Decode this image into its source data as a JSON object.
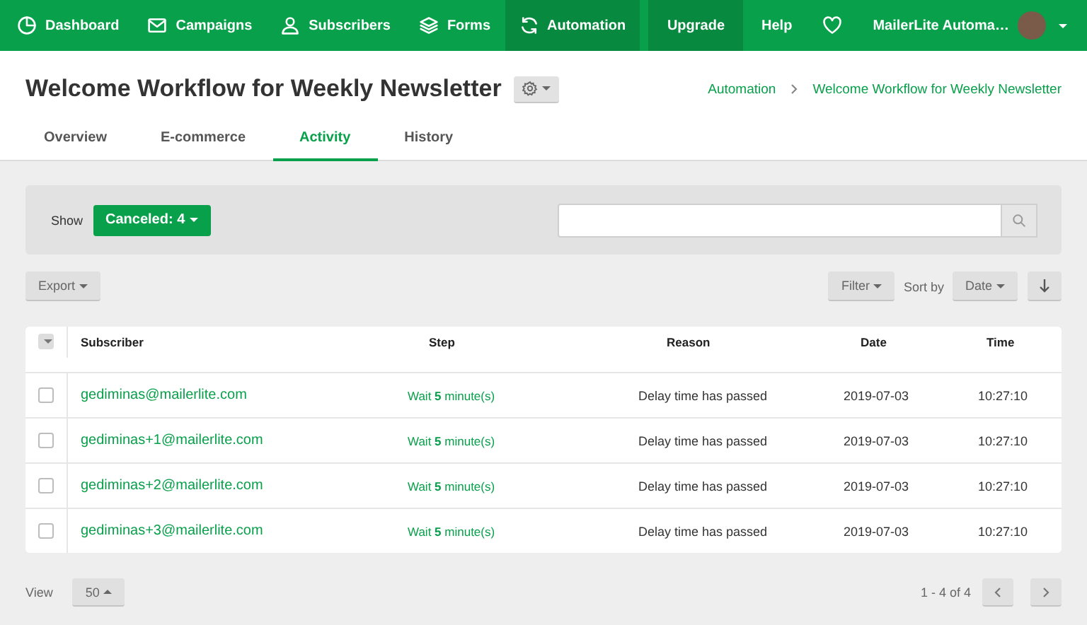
{
  "nav": {
    "items": [
      {
        "label": "Dashboard",
        "selected": false
      },
      {
        "label": "Campaigns",
        "selected": false
      },
      {
        "label": "Subscribers",
        "selected": false
      },
      {
        "label": "Forms",
        "selected": false
      },
      {
        "label": "Automation",
        "selected": true
      }
    ],
    "upgrade": "Upgrade",
    "help": "Help",
    "user": "MailerLite Automa…"
  },
  "header": {
    "title": "Welcome Workflow for Weekly Newsletter",
    "breadcrumb": [
      "Automation",
      "Welcome Workflow for Weekly Newsletter"
    ],
    "tabs": [
      {
        "label": "Overview",
        "selected": false
      },
      {
        "label": "E-commerce",
        "selected": false
      },
      {
        "label": "Activity",
        "selected": true
      },
      {
        "label": "History",
        "selected": false
      }
    ]
  },
  "filter": {
    "show_label": "Show",
    "status_button": "Canceled: 4"
  },
  "toolbar": {
    "export": "Export",
    "filter": "Filter",
    "sort_label": "Sort by",
    "sort_button": "Date"
  },
  "table": {
    "columns": [
      "Subscriber",
      "Step",
      "Reason",
      "Date",
      "Time"
    ],
    "rows": [
      {
        "checked": false,
        "subscriber": "gediminas@mailerlite.com",
        "step": "Wait **5** minute(s)",
        "reason": "Delay time has passed",
        "date": "2019-07-03",
        "time": "10:27:10"
      },
      {
        "checked": false,
        "subscriber": "gediminas+1@mailerlite.com",
        "step": "Wait **5** minute(s)",
        "reason": "Delay time has passed",
        "date": "2019-07-03",
        "time": "10:27:10"
      },
      {
        "checked": false,
        "subscriber": "gediminas+2@mailerlite.com",
        "step": "Wait **5** minute(s)",
        "reason": "Delay time has passed",
        "date": "2019-07-03",
        "time": "10:27:10"
      },
      {
        "checked": false,
        "subscriber": "gediminas+3@mailerlite.com",
        "step": "Wait **5** minute(s)",
        "reason": "Delay time has passed",
        "date": "2019-07-03",
        "time": "10:27:10"
      }
    ]
  },
  "footer": {
    "view_label": "View",
    "page_size": "50",
    "range": "1 - 4 of 4"
  }
}
